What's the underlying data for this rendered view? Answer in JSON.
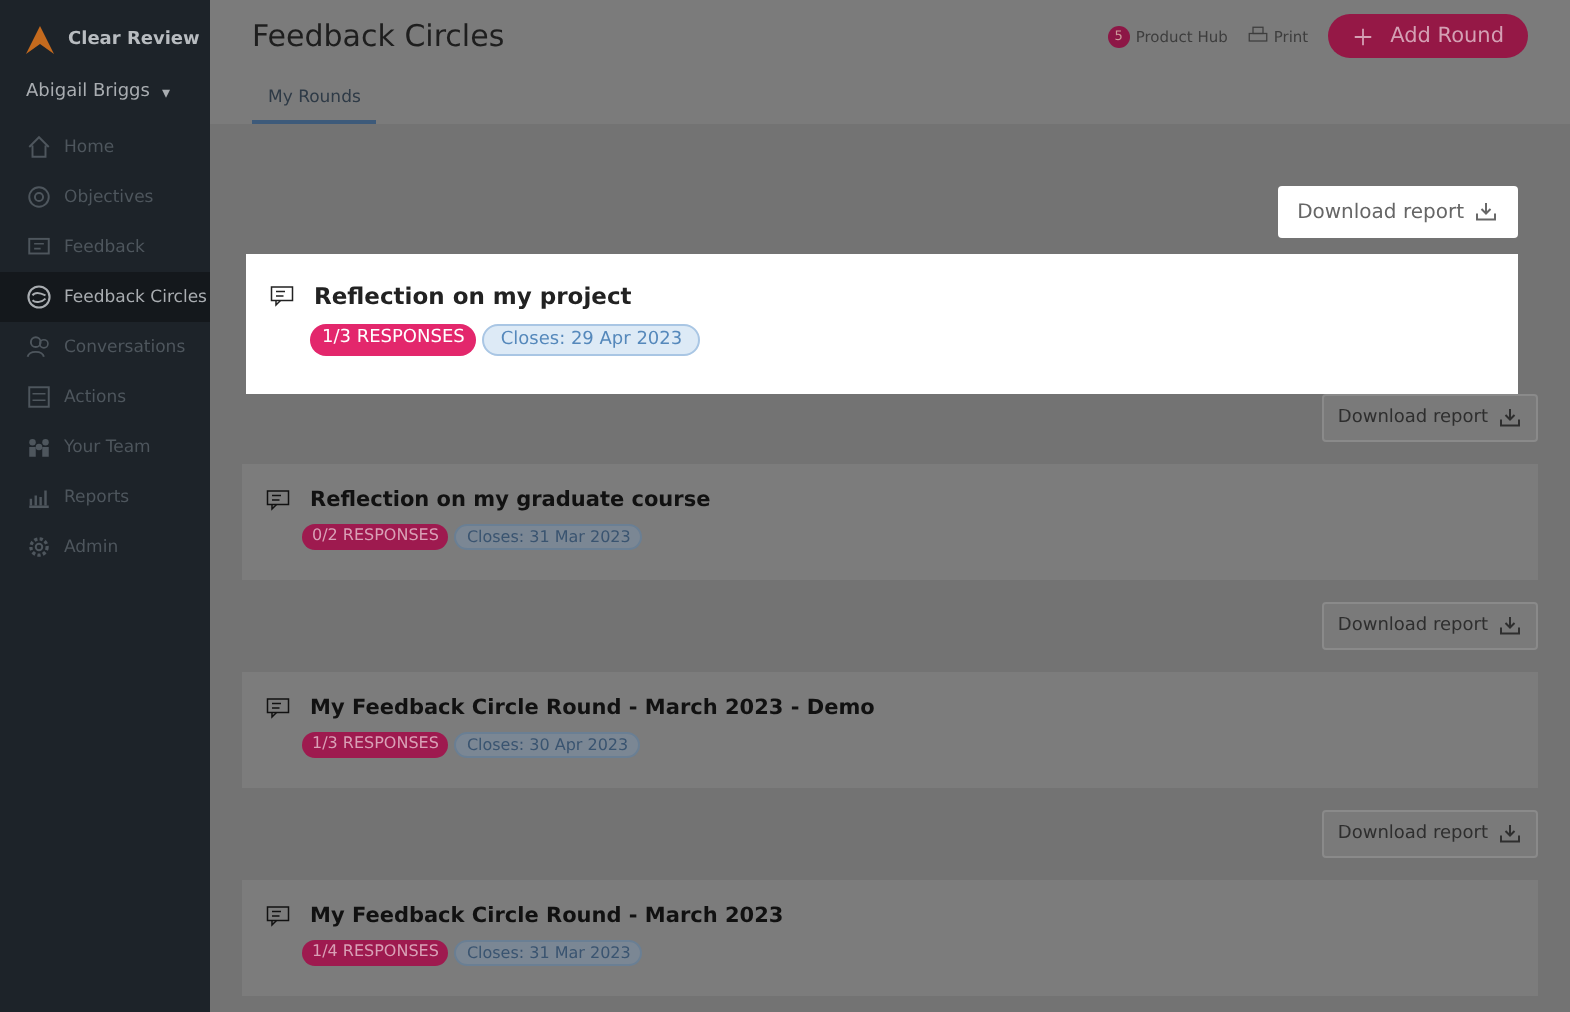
{
  "sidebar": {
    "brand": "Clear Review",
    "user": "Abigail Briggs",
    "user_caret": "▾",
    "items": [
      {
        "label": "Home",
        "kind": "home",
        "selected": false
      },
      {
        "label": "Objectives",
        "kind": "target",
        "selected": false
      },
      {
        "label": "Feedback",
        "kind": "chat",
        "selected": false
      },
      {
        "label": "Feedback Circles",
        "kind": "circles",
        "selected": true
      },
      {
        "label": "Conversations",
        "kind": "people",
        "selected": false
      },
      {
        "label": "Actions",
        "kind": "list",
        "selected": false
      },
      {
        "label": "Your Team",
        "kind": "team",
        "selected": false
      },
      {
        "label": "Reports",
        "kind": "chart",
        "selected": false
      },
      {
        "label": "Admin",
        "kind": "gear",
        "selected": false
      }
    ]
  },
  "header": {
    "title": "Feedback Circles",
    "product_hub": {
      "count": "5",
      "label": "Product Hub"
    },
    "print": "Print",
    "add_button": "Add Round"
  },
  "tabs": [
    {
      "label": "My Rounds",
      "selected": true
    }
  ],
  "rounds": [
    {
      "title": "Reflection on my project",
      "responses": "1/3 RESPONSES",
      "closes": "Closes: 29 Apr 2023",
      "download": "Download report",
      "highlighted": true
    },
    {
      "title": "Reflection on my graduate course",
      "responses": "0/2 RESPONSES",
      "closes": "Closes: 31 Mar 2023",
      "download": "Download report",
      "highlighted": false
    },
    {
      "title": "My Feedback Circle Round - March 2023 - Demo",
      "responses": "1/3 RESPONSES",
      "closes": "Closes: 30 Apr 2023",
      "download": "Download report",
      "highlighted": false
    },
    {
      "title": "My Feedback Circle Round - March 2023",
      "responses": "1/4 RESPONSES",
      "closes": "Closes: 31 Mar 2023",
      "download": "Download report",
      "highlighted": false
    }
  ]
}
